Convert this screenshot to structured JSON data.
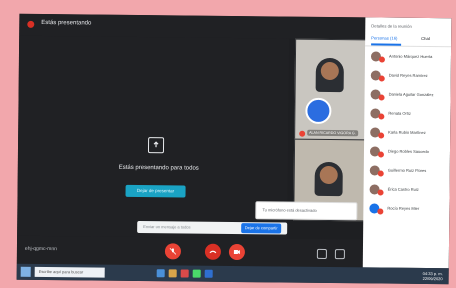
{
  "meeting": {
    "top_title": "Estás presentando",
    "present_message": "Estás presentando para todos",
    "stop_button": "Dejar de presentar",
    "meeting_code": "ehj-qgmc-mnn",
    "chat_hint": "Enviar un mensaje a todos",
    "chat_send": "Dejar de compartir",
    "toast": "Tu micrófono está desactivado"
  },
  "tiles": {
    "tile1_name": "ALAN RICARDO VIGORA G."
  },
  "sidebar": {
    "title": "Detalles de la reunión",
    "tab_people": "Personas (16)",
    "tab_chat": "Chat",
    "participants": [
      {
        "name": "Antonio Márquez Huerta",
        "style": "brown"
      },
      {
        "name": "David Reyes Ramírez",
        "style": "brown"
      },
      {
        "name": "Daniela Aguilar González",
        "style": "brown"
      },
      {
        "name": "Renata Ortiz",
        "style": "brown"
      },
      {
        "name": "Karla Rubio Martínez",
        "style": "brown"
      },
      {
        "name": "Diego Robles Saucedo",
        "style": "brown"
      },
      {
        "name": "Guillermo Ruiz Flores",
        "style": "brown"
      },
      {
        "name": "Érica Castro Ruiz",
        "style": "brown"
      },
      {
        "name": "Rocío Reyes Mier",
        "style": "lightblue"
      }
    ]
  },
  "taskbar": {
    "search_placeholder": "Escribe aquí para buscar",
    "time": "04:33 p. m.",
    "date": "22/09/2020"
  }
}
